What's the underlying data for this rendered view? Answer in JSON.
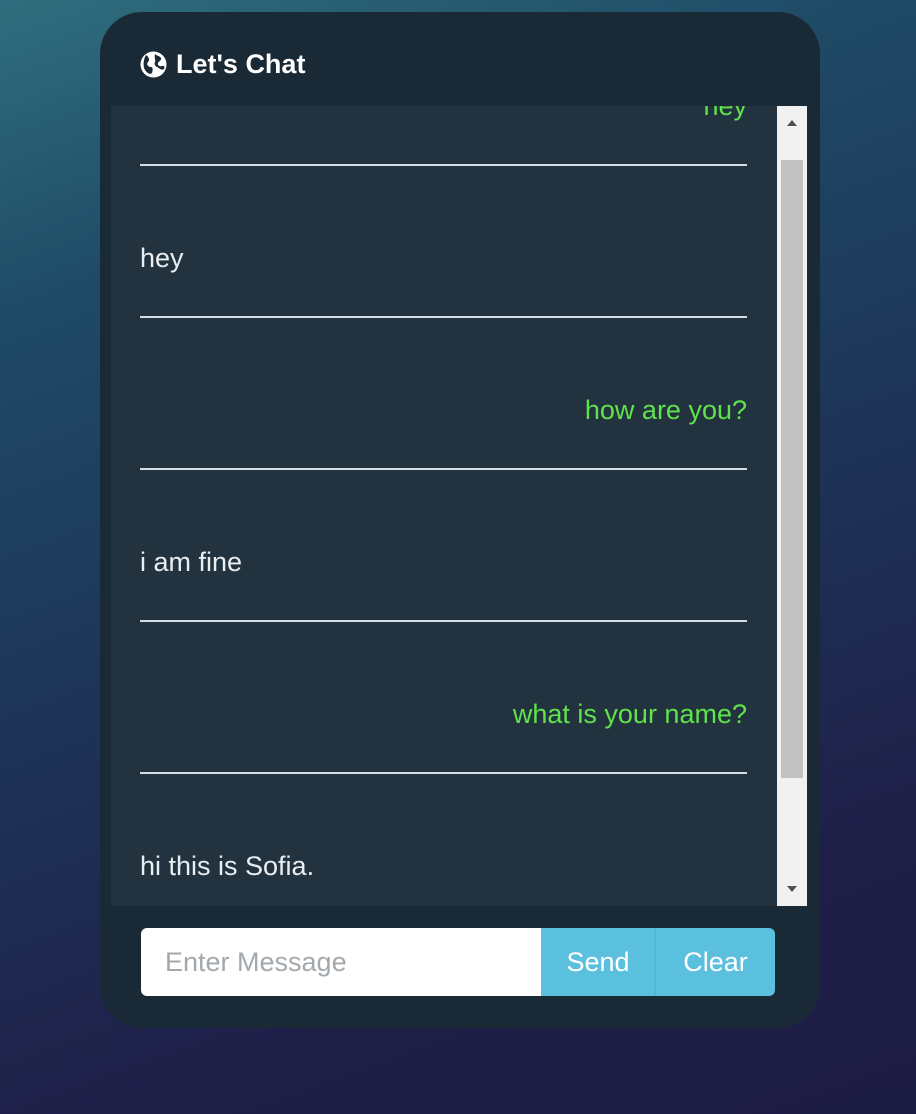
{
  "header": {
    "title": "Let's Chat",
    "icon": "globe-icon"
  },
  "messages": [
    {
      "text": "hey",
      "direction": "sent"
    },
    {
      "text": "hey",
      "direction": "received"
    },
    {
      "text": "how are you?",
      "direction": "sent"
    },
    {
      "text": "i am fine",
      "direction": "received"
    },
    {
      "text": "what is your name?",
      "direction": "sent"
    },
    {
      "text": "hi this is Sofia.",
      "direction": "received"
    }
  ],
  "composer": {
    "placeholder": "Enter Message",
    "value": "",
    "send_label": "Send",
    "clear_label": "Clear"
  },
  "colors": {
    "sent_text": "#5ee44a",
    "received_text": "#e8eef2",
    "button": "#5bc0de",
    "panel": "#1a2936",
    "messages_bg": "#22333f"
  }
}
